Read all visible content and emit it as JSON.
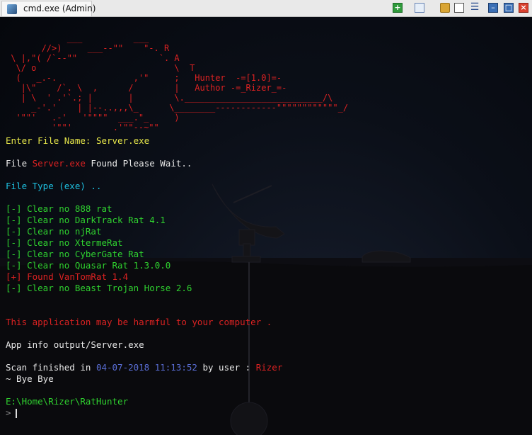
{
  "titlebar": {
    "tab_title": "cmd.exe (Admin)",
    "icons": [
      "app-icon",
      "new-console-plus-icon",
      "layout-icon",
      "lock-icon",
      "panes-icon",
      "menu-icon",
      "minimize-icon",
      "maximize-icon",
      "close-icon"
    ]
  },
  "banner": {
    "ascii_art": "            ___          ___\n       //>)     ___--\"\"    \"-. R\n \\ |,\"( /`--\"\"                `. A\n  \\/ o                           \\  T\n  (   _.-.               ,'\"     ;   Hunter  -=[1.0]=-\n   |\\\"    /`. \\  ,      /        |   Author -=_Rizer_=-\n   | \\  ' .'`.; |       |        \\.___________________________/\\\n     _-'.'    | |--..,,,\\_      \\________------------\"\"\"\"\"\"\"\"\"\"\"\"_/\n  '\"\"'   .-'   '\"\"\"\"  ___.\"_     )\n         '\"\"'        .'\"\"--~\"\"",
    "title_line": "Hunter  -=[1.0]=-",
    "author_line": "Author -=_Rizer_=-"
  },
  "console": {
    "file_prompt_label": "Enter File Name: ",
    "file_name": "Server.exe",
    "found_prefix": "File ",
    "found_file": "Server.exe",
    "found_suffix": " Found Please Wait..",
    "file_type": "File Type (exe) ..",
    "scan_results": [
      {
        "status": "[-]",
        "text": "Clear no 888 rat",
        "color": "#2fd12f"
      },
      {
        "status": "[-]",
        "text": "Clear no DarkTrack Rat 4.1",
        "color": "#2fd12f"
      },
      {
        "status": "[-]",
        "text": "Clear no njRat",
        "color": "#2fd12f"
      },
      {
        "status": "[-]",
        "text": "Clear no XtermeRat",
        "color": "#2fd12f"
      },
      {
        "status": "[-]",
        "text": "Clear no CyberGate Rat",
        "color": "#2fd12f"
      },
      {
        "status": "[-]",
        "text": "Clear no Quasar Rat 1.3.0.0",
        "color": "#2fd12f"
      },
      {
        "status": "[+]",
        "text": "Found VanTomRat 1.4",
        "color": "#dd2222"
      },
      {
        "status": "[-]",
        "text": "Clear no Beast Trojan Horse 2.6",
        "color": "#2fd12f"
      }
    ],
    "warning": "This application may be harmful to your computer .",
    "info_output": "App info output/Server.exe",
    "scan_finished_prefix": "Scan finished in ",
    "scan_date": "04-07-2018 11:13:52",
    "scan_by": " by user : ",
    "scan_user": "Rizer",
    "bye": "~ Bye Bye",
    "cwd": "E:\\Home\\Rizer\\RatHunter",
    "prompt_symbol": ">"
  },
  "colors": {
    "red": "#dd2222",
    "green": "#2fd12f",
    "yellow": "#e6e64a",
    "cyan": "#1ec0e0",
    "blue": "#5a6ed6",
    "white": "#e8e8e8",
    "titlebar": "#e9e9e9"
  }
}
